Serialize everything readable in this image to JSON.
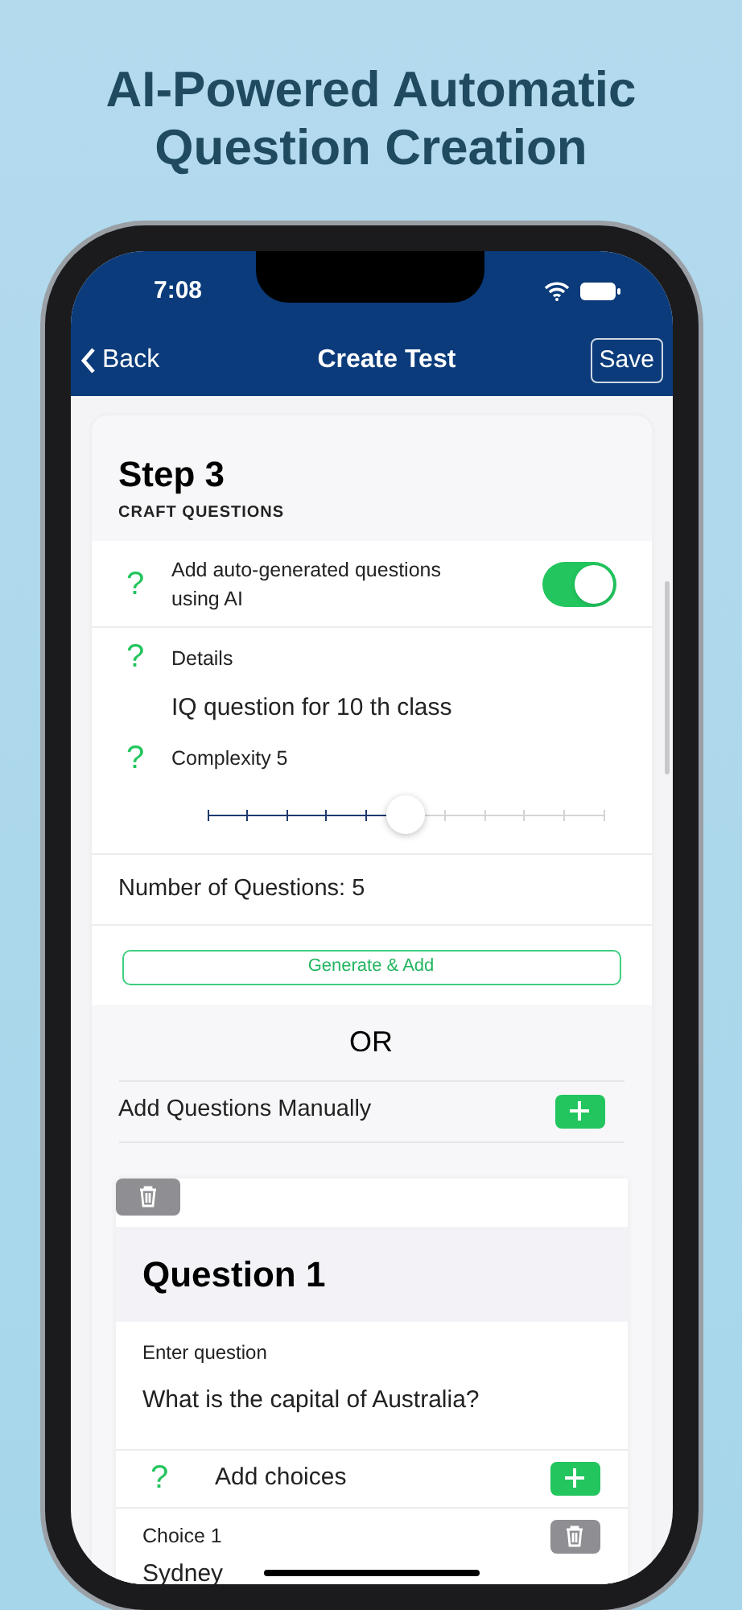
{
  "headline": "AI-Powered Automatic Question Creation",
  "status_bar": {
    "time": "7:08"
  },
  "nav": {
    "back": "Back",
    "title": "Create Test",
    "save": "Save"
  },
  "step": {
    "title": "Step 3",
    "subtitle": "CRAFT QUESTIONS"
  },
  "ai": {
    "toggle": {
      "help": "?",
      "label": "Add auto-generated questions using AI",
      "on": true
    },
    "details": {
      "help": "?",
      "label": "Details",
      "value": "IQ question for 10 th class"
    },
    "complexity": {
      "help": "?",
      "label": "Complexity 5",
      "level": 0.5
    },
    "count": "Number of Questions: 5",
    "generate": "Generate & Add"
  },
  "or": "OR",
  "manual": {
    "label": "Add Questions Manually"
  },
  "question": {
    "title": "Question 1",
    "field_label": "Enter question",
    "field_value": "What is the capital of Australia?",
    "add_choices": {
      "help": "?",
      "label": "Add choices"
    },
    "choices": [
      {
        "label": "Choice 1",
        "value": "Sydney"
      }
    ]
  }
}
